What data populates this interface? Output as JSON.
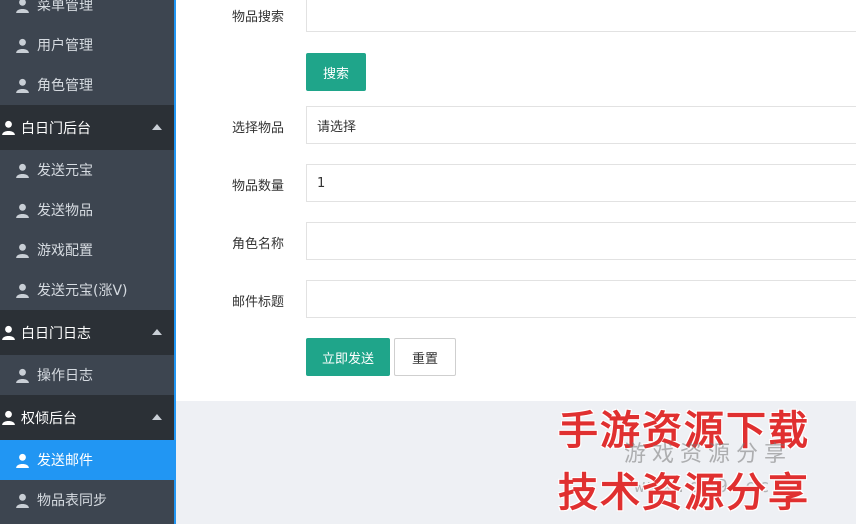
{
  "sidebar": {
    "items": [
      {
        "label": "菜单管理",
        "type": "item"
      },
      {
        "label": "用户管理",
        "type": "item"
      },
      {
        "label": "角色管理",
        "type": "item"
      },
      {
        "label": "白日门后台",
        "type": "group"
      },
      {
        "label": "发送元宝",
        "type": "item"
      },
      {
        "label": "发送物品",
        "type": "item"
      },
      {
        "label": "游戏配置",
        "type": "item"
      },
      {
        "label": "发送元宝(涨V)",
        "type": "item"
      },
      {
        "label": "白日门日志",
        "type": "group"
      },
      {
        "label": "操作日志",
        "type": "item"
      },
      {
        "label": "权倾后台",
        "type": "group"
      },
      {
        "label": "发送邮件",
        "type": "item",
        "active": true
      },
      {
        "label": "物品表同步",
        "type": "item"
      }
    ]
  },
  "form": {
    "search_label": "物品搜索",
    "search_value": "",
    "search_button": "搜索",
    "select_label": "选择物品",
    "select_value": "请选择",
    "quantity_label": "物品数量",
    "quantity_value": "1",
    "role_label": "角色名称",
    "role_value": "",
    "mail_title_label": "邮件标题",
    "mail_title_value": "",
    "submit_button": "立即发送",
    "reset_button": "重置"
  },
  "watermark": {
    "line1": "手游资源下载",
    "line2": "游戏资源分享",
    "line3": "技术资源分享",
    "url": "www.gm9.cc"
  },
  "colors": {
    "sidebar_bg": "#3d4550",
    "group_bg": "#2b3036",
    "active_bg": "#2196f3",
    "primary_button": "#1fa58a",
    "watermark": "#e03030"
  }
}
